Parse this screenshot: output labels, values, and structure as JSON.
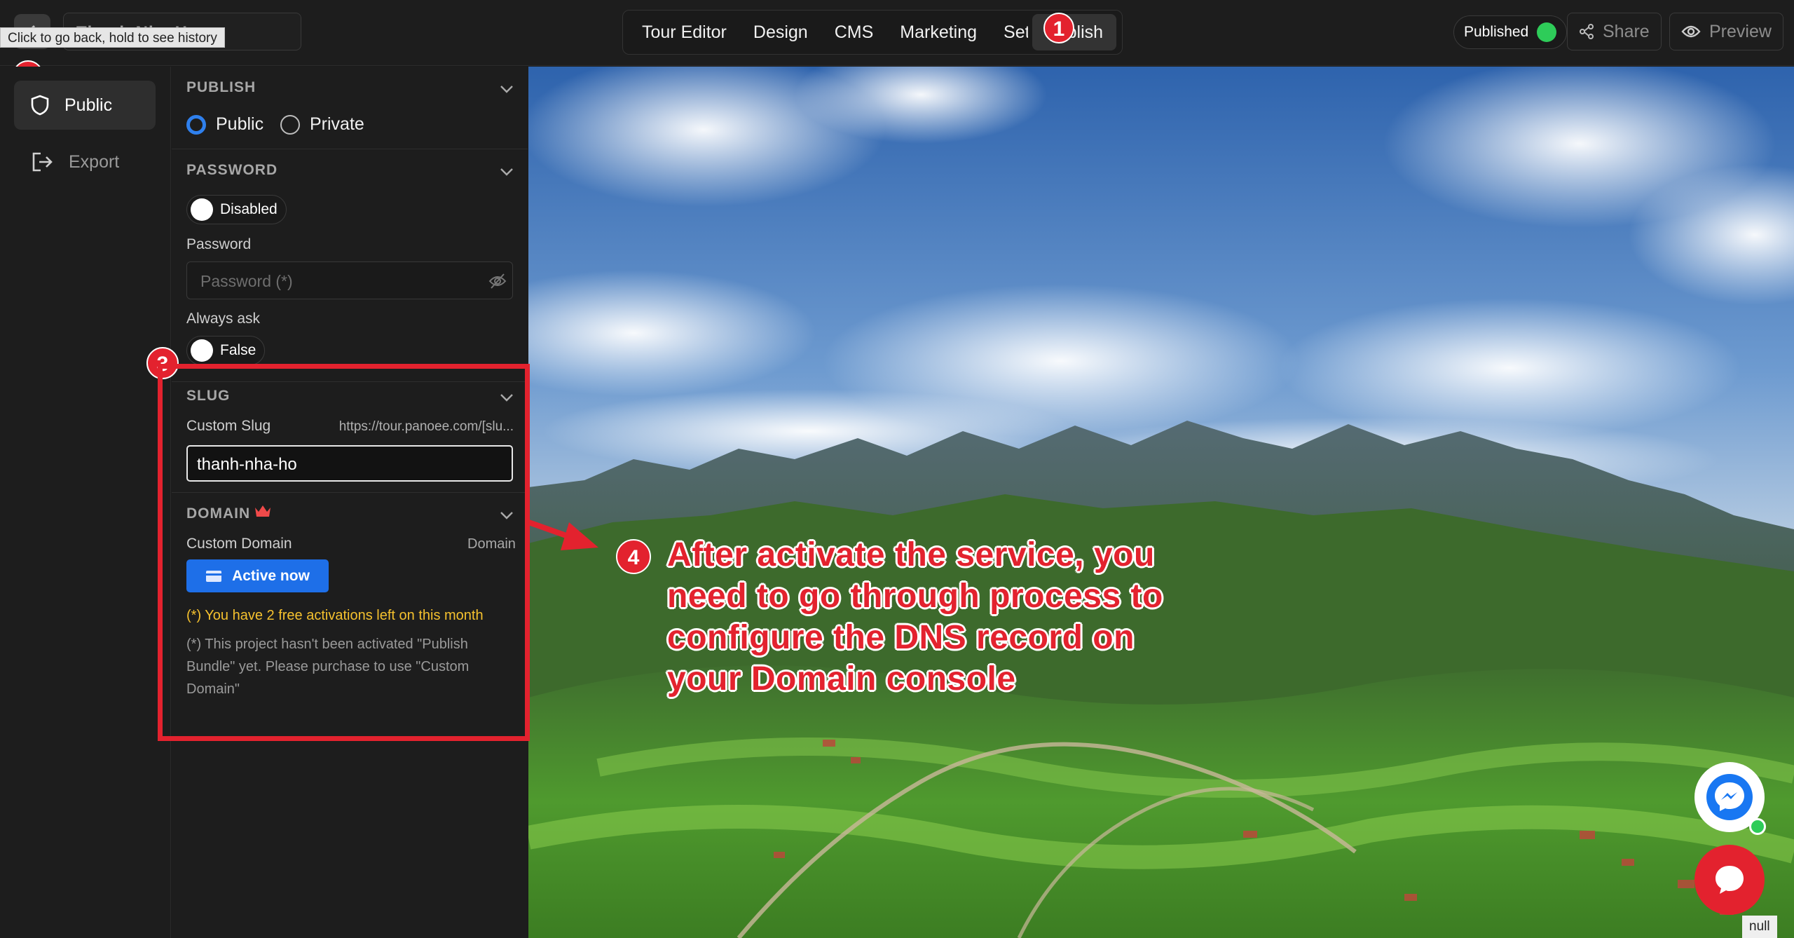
{
  "window": {
    "title_obscured": "Thanh Nha Ho",
    "back_tooltip": "Click to go back, hold to see history"
  },
  "nav": {
    "tabs": [
      {
        "label": "Tour Editor"
      },
      {
        "label": "Design"
      },
      {
        "label": "CMS"
      },
      {
        "label": "Marketing"
      },
      {
        "label": "Settings"
      },
      {
        "label": "Publish",
        "active": true
      }
    ]
  },
  "header_right": {
    "status_label": "Published",
    "status_color": "#2ecc59",
    "share_label": "Share",
    "preview_label": "Preview"
  },
  "sidebar": {
    "items": [
      {
        "label": "Public",
        "icon": "shield-icon",
        "active": true
      },
      {
        "label": "Export",
        "icon": "export-icon",
        "active": false
      }
    ]
  },
  "panel": {
    "publish": {
      "heading": "PUBLISH",
      "options": [
        {
          "label": "Public",
          "selected": true
        },
        {
          "label": "Private",
          "selected": false
        }
      ]
    },
    "password": {
      "heading": "PASSWORD",
      "toggle_label": "Disabled",
      "field_label": "Password",
      "placeholder": "Password (*)",
      "always_ask_label": "Always ask",
      "always_ask_value": "False"
    },
    "slug": {
      "heading": "SLUG",
      "field_label": "Custom Slug",
      "url_hint": "https://tour.panoee.com/[slu...",
      "value": "thanh-nha-ho"
    },
    "domain": {
      "heading": "DOMAIN",
      "field_label": "Custom Domain",
      "right_label": "Domain",
      "button_label": "Active now",
      "free_note": "(*) You have 2 free activations left on this month",
      "info_note": "(*) This project hasn't been activated \"Publish Bundle\" yet. Please purchase to use \"Custom Domain\""
    }
  },
  "annotations": {
    "steps": [
      "1",
      "2",
      "3",
      "4"
    ],
    "callout": "After activate the service, you need to go through process to configure the DNS record on your Domain console",
    "accent_color": "#e3222e"
  },
  "widgets": {
    "messenger_icon": "messenger-icon",
    "chat_icon": "chat-icon",
    "null_label": "null"
  }
}
